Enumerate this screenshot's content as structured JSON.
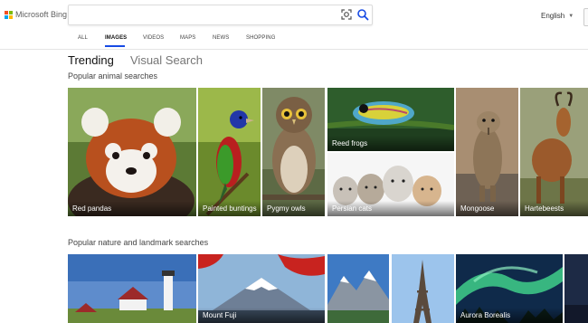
{
  "header": {
    "logo_text": "Microsoft Bing",
    "search_value": "",
    "language": "English"
  },
  "nav": {
    "tabs": [
      "ALL",
      "IMAGES",
      "VIDEOS",
      "MAPS",
      "NEWS",
      "SHOPPING"
    ],
    "active": "IMAGES"
  },
  "subtabs": [
    "Trending",
    "Visual Search"
  ],
  "sections": [
    {
      "title": "Popular animal searches",
      "tiles": [
        {
          "label": "Red pandas",
          "icon": "red-panda-image"
        },
        {
          "label": "Painted buntings",
          "icon": "bird-image"
        },
        {
          "label": "Pygmy owls",
          "icon": "owl-image"
        },
        {
          "label": "Reed frogs",
          "icon": "frog-image"
        },
        {
          "label": "Persian cats",
          "icon": "kittens-image"
        },
        {
          "label": "Mongoose",
          "icon": "mongoose-image"
        },
        {
          "label": "Hartebeests",
          "icon": "antelope-image"
        }
      ]
    },
    {
      "title": "Popular nature and landmark searches",
      "tiles": [
        {
          "label": "",
          "icon": "lighthouse-image"
        },
        {
          "label": "Mount Fuji",
          "icon": "mountain-image"
        },
        {
          "label": "",
          "icon": "alps-image"
        },
        {
          "label": "",
          "icon": "eiffel-tower-image"
        },
        {
          "label": "Aurora Borealis",
          "icon": "aurora-image"
        },
        {
          "label": "",
          "icon": "night-sky-image"
        }
      ]
    }
  ],
  "colors": {
    "accent": "#174ae4",
    "logo": [
      "#f25022",
      "#7fba00",
      "#00a4ef",
      "#ffb900"
    ]
  }
}
